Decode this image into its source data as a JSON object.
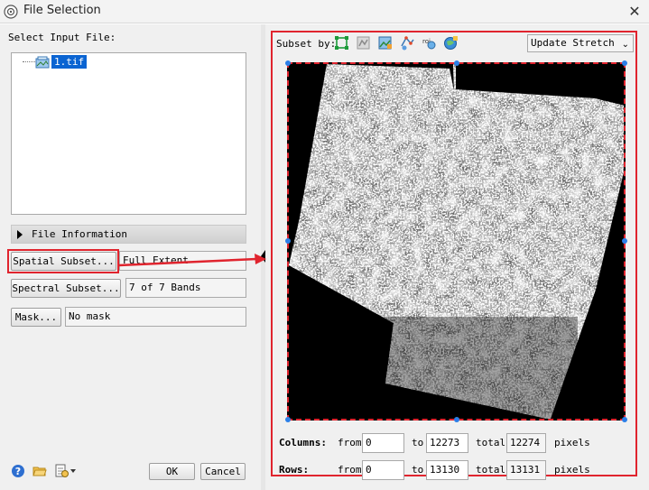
{
  "window": {
    "title": "File Selection",
    "close_glyph": "✕"
  },
  "left": {
    "select_input_label": "Select Input File:",
    "files": [
      {
        "name": "1.tif",
        "selected": true
      }
    ],
    "file_info_label": "File Information",
    "spatial_subset": {
      "button": "Spatial Subset...",
      "value": "Full Extent"
    },
    "spectral_subset": {
      "button": "Spectral Subset...",
      "value": "7 of 7 Bands"
    },
    "mask": {
      "button": "Mask...",
      "value": "No mask"
    },
    "ok_label": "OK",
    "cancel_label": "Cancel",
    "bottom_icons": [
      "help-icon",
      "open-folder-icon",
      "file-options-icon"
    ]
  },
  "right": {
    "subset_by_label": "Subset by:",
    "subset_tools": [
      "image-subset-icon",
      "roi-subset-icon",
      "file-subset-icon",
      "vector-subset-icon",
      "roi-file-icon",
      "map-subset-icon"
    ],
    "stretch_option": "Update Stretch",
    "columns": {
      "label": "Columns:",
      "from_label": "from",
      "from": "0",
      "to_label": "to",
      "to": "12273",
      "total_label": "total",
      "total": "12274",
      "unit": "pixels"
    },
    "rows": {
      "label": "Rows:",
      "from_label": "from",
      "from": "0",
      "to_label": "to",
      "to": "13130",
      "total_label": "total",
      "total": "13131",
      "unit": "pixels"
    }
  },
  "colors": {
    "highlight_red": "#e0242e",
    "selection_blue": "#0a64d2",
    "handle_blue": "#2b7fe8"
  }
}
